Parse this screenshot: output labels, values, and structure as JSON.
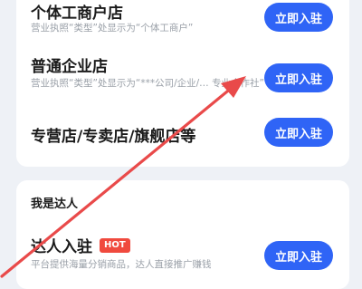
{
  "merchant_types": [
    {
      "title": "个体工商户店",
      "desc": "营业执照“类型”处显示为“个体工商户”",
      "button": "立即入驻"
    },
    {
      "title": "普通企业店",
      "desc": "营业执照“类型”处显示为“***公司/企业/… 专业合作社”",
      "button": "立即入驻"
    },
    {
      "title": "专营店/专卖店/旗舰店等",
      "desc": "",
      "button": "立即入驻"
    }
  ],
  "influencer_section": {
    "title": "我是达人",
    "item": {
      "title": "达人入驻",
      "badge": "HOT",
      "desc": "平台提供海量分销商品，达人直接推广赚钱",
      "button": "立即入驻"
    }
  },
  "colors": {
    "primary_button": "#2f64f6",
    "annotation_arrow": "#e94a4a",
    "badge": "#f04a3e"
  }
}
